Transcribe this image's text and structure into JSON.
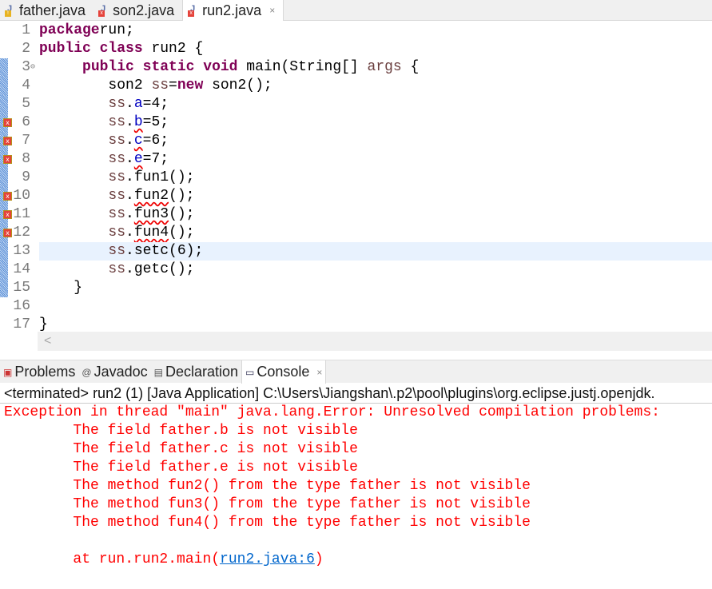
{
  "tabs": [
    {
      "label": "father.java",
      "marker": "warning"
    },
    {
      "label": "son2.java",
      "marker": "error"
    },
    {
      "label": "run2.java",
      "marker": "error",
      "active": true,
      "close": "×"
    }
  ],
  "editor": {
    "lines": [
      {
        "n": "1",
        "tokens": [
          [
            "kw",
            "package"
          ],
          [
            "",
            "run;"
          ]
        ]
      },
      {
        "n": "2",
        "tokens": [
          [
            "kw",
            "public"
          ],
          [
            "",
            " "
          ],
          [
            "kw",
            "class"
          ],
          [
            "",
            " run2 {"
          ]
        ]
      },
      {
        "n": "3",
        "fold": "⊖",
        "tokens": [
          [
            "",
            " "
          ],
          [
            "kw",
            "public"
          ],
          [
            "",
            " "
          ],
          [
            "kw",
            "static"
          ],
          [
            "",
            " "
          ],
          [
            "kw",
            "void"
          ],
          [
            "",
            " main(String[] "
          ],
          [
            "var",
            "args"
          ],
          [
            "",
            " {"
          ]
        ],
        "indent": 4
      },
      {
        "n": "4",
        "tokens": [
          [
            "",
            "son2 "
          ],
          [
            "var",
            "ss"
          ],
          [
            "",
            "="
          ],
          [
            "kw",
            "new"
          ],
          [
            "",
            " son2();"
          ]
        ],
        "indent": 8
      },
      {
        "n": "5",
        "tokens": [
          [
            "var",
            "ss"
          ],
          [
            "",
            "."
          ],
          [
            "fld",
            "a"
          ],
          [
            "",
            "=4;"
          ]
        ],
        "indent": 8
      },
      {
        "n": "6",
        "error": true,
        "tokens": [
          [
            "var",
            "ss"
          ],
          [
            "",
            "."
          ],
          [
            "fld err",
            "b"
          ],
          [
            "",
            "=5;"
          ]
        ],
        "indent": 8
      },
      {
        "n": "7",
        "error": true,
        "tokens": [
          [
            "var",
            "ss"
          ],
          [
            "",
            "."
          ],
          [
            "fld err",
            "c"
          ],
          [
            "",
            "=6;"
          ]
        ],
        "indent": 8
      },
      {
        "n": "8",
        "error": true,
        "tokens": [
          [
            "var",
            "ss"
          ],
          [
            "",
            "."
          ],
          [
            "fld err",
            "e"
          ],
          [
            "",
            "=7;"
          ]
        ],
        "indent": 8
      },
      {
        "n": "9",
        "tokens": [
          [
            "var",
            "ss"
          ],
          [
            "",
            ".fun1();"
          ]
        ],
        "indent": 8
      },
      {
        "n": "10",
        "error": true,
        "tokens": [
          [
            "var",
            "ss"
          ],
          [
            "",
            "."
          ],
          [
            "err",
            "fun2"
          ],
          [
            "",
            "();"
          ]
        ],
        "indent": 8
      },
      {
        "n": "11",
        "error": true,
        "tokens": [
          [
            "var",
            "ss"
          ],
          [
            "",
            "."
          ],
          [
            "err",
            "fun3"
          ],
          [
            "",
            "();"
          ]
        ],
        "indent": 8
      },
      {
        "n": "12",
        "error": true,
        "tokens": [
          [
            "var",
            "ss"
          ],
          [
            "",
            "."
          ],
          [
            "err",
            "fun4"
          ],
          [
            "",
            "();"
          ]
        ],
        "indent": 8
      },
      {
        "n": "13",
        "highlight": true,
        "tokens": [
          [
            "var",
            "ss"
          ],
          [
            "",
            ".setc(6);"
          ]
        ],
        "indent": 8
      },
      {
        "n": "14",
        "tokens": [
          [
            "var",
            "ss"
          ],
          [
            "",
            ".getc();"
          ]
        ],
        "indent": 8
      },
      {
        "n": "15",
        "tokens": [
          [
            "",
            "}"
          ]
        ],
        "indent": 4
      },
      {
        "n": "16",
        "tokens": []
      },
      {
        "n": "17",
        "tokens": [
          [
            "",
            "}"
          ]
        ]
      }
    ],
    "scroll_left": "<"
  },
  "panel": {
    "tabs": [
      {
        "label": "Problems",
        "icon": "problems-icon"
      },
      {
        "label": "Javadoc",
        "icon": "at-icon"
      },
      {
        "label": "Declaration",
        "icon": "declaration-icon"
      },
      {
        "label": "Console",
        "icon": "console-icon",
        "active": true
      }
    ],
    "close": "×",
    "terminated": "<terminated> run2 (1) [Java Application] C:\\Users\\Jiangshan\\.p2\\pool\\plugins\\org.eclipse.justj.openjdk.",
    "console_lines": [
      "Exception in thread \"main\" java.lang.Error: Unresolved compilation problems: ",
      "\tThe field father.b is not visible",
      "\tThe field father.c is not visible",
      "\tThe field father.e is not visible",
      "\tThe method fun2() from the type father is not visible",
      "\tThe method fun3() from the type father is not visible",
      "\tThe method fun4() from the type father is not visible",
      ""
    ],
    "trace_prefix": "\tat run.run2.main(",
    "trace_link": "run2.java:6",
    "trace_suffix": ")"
  },
  "colors": {
    "keyword": "#7f0055",
    "field": "#0000c0",
    "local": "#6a3e3e",
    "error": "#ff0000",
    "link": "#0066cc",
    "current_line": "#e8f2fe"
  }
}
